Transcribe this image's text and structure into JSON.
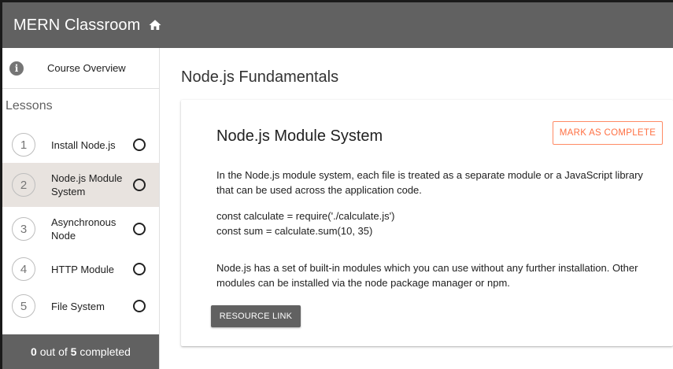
{
  "app": {
    "title": "MERN Classroom",
    "home_icon": "home-icon"
  },
  "sidebar": {
    "overview_label": "Course Overview",
    "lessons_heading": "Lessons",
    "lessons": [
      {
        "number": "1",
        "label": "Install Node.js",
        "completed": false,
        "active": false
      },
      {
        "number": "2",
        "label": "Node.js Module System",
        "completed": false,
        "active": true
      },
      {
        "number": "3",
        "label": "Asynchronous Node",
        "completed": false,
        "active": false
      },
      {
        "number": "4",
        "label": "HTTP Module",
        "completed": false,
        "active": false
      },
      {
        "number": "5",
        "label": "File System",
        "completed": false,
        "active": false
      }
    ],
    "progress": {
      "completed": "0",
      "middle": " out of ",
      "total": "5",
      "suffix": " completed"
    }
  },
  "main": {
    "course_title": "Node.js Fundamentals",
    "lesson_title": "Node.js Module System",
    "mark_complete_label": "MARK AS COMPLETE",
    "paragraph1": "In the Node.js module system, each file is treated as a separate module or a JavaScript library that can be used across the application code.",
    "code_line1": "const calculate = require('./calculate.js')",
    "code_line2": "const sum = calculate.sum(10, 35)",
    "paragraph3": "Node.js has a set of built-in modules which you can use without any further installation. Other modules can be installed via the node package manager or npm.",
    "resource_link_label": "RESOURCE LINK"
  },
  "colors": {
    "appbar": "#616161",
    "accent": "#ff7043",
    "active_lesson": "#e8e3df"
  }
}
